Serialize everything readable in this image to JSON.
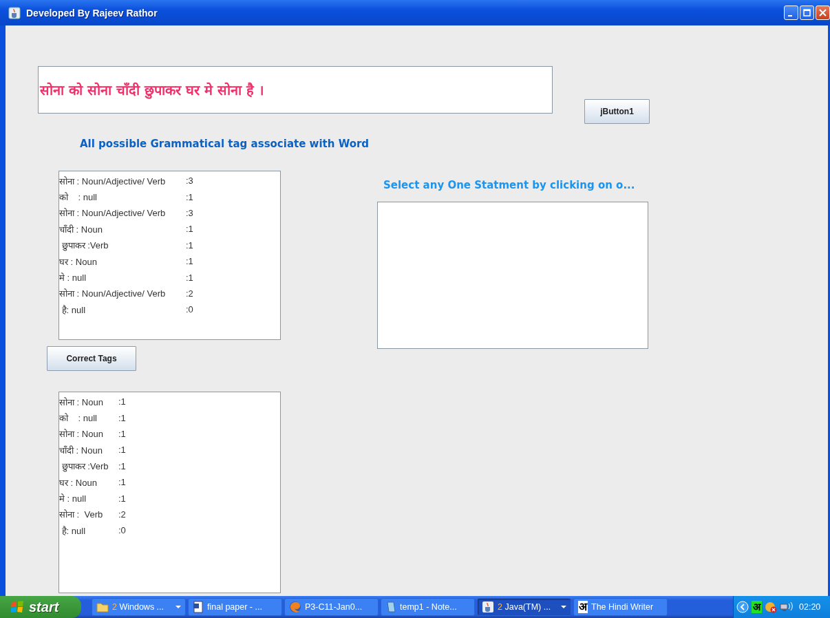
{
  "window": {
    "title": "Developed By Rajeev Rathor"
  },
  "sentence_field": {
    "value": "सोना को सोना चाँदी छुपाकर घर मे सोना है ।"
  },
  "top_button": {
    "label": "jButton1"
  },
  "possible_tags": {
    "label": "All possible Grammatical tag associate with Word",
    "rows": [
      {
        "text": "सोना : Noun/Adjective/ Verb",
        "count": ":3"
      },
      {
        "text": "को    : null",
        "count": ":1"
      },
      {
        "text": "सोना : Noun/Adjective/ Verb",
        "count": ":3"
      },
      {
        "text": "चाँदी : Noun",
        "count": ":1"
      },
      {
        "text": " छुपाकर :Verb",
        "count": ":1"
      },
      {
        "text": "घर : Noun",
        "count": ":1"
      },
      {
        "text": "मे : null",
        "count": ":1"
      },
      {
        "text": "सोना : Noun/Adjective/ Verb",
        "count": ":2"
      },
      {
        "text": " है: null",
        "count": ":0"
      }
    ]
  },
  "correct_tags_button": {
    "label": "Correct Tags"
  },
  "correct_tags": {
    "rows": [
      {
        "text": "सोना : Noun",
        "count": ":1"
      },
      {
        "text": "को    : null",
        "count": ":1"
      },
      {
        "text": "सोना : Noun",
        "count": ":1"
      },
      {
        "text": "चाँदी : Noun",
        "count": ":1"
      },
      {
        "text": " छुपाकर :Verb",
        "count": ":1"
      },
      {
        "text": "घर : Noun",
        "count": ":1"
      },
      {
        "text": "मे : null",
        "count": ":1"
      },
      {
        "text": "सोना :  Verb",
        "count": ":2"
      },
      {
        "text": " है: null",
        "count": ":0"
      }
    ]
  },
  "statement": {
    "label": "Select any One Statment by clicking on o..."
  },
  "taskbar": {
    "start": "start",
    "tasks": [
      {
        "kind": "folder",
        "count": "2",
        "label": "Windows ...",
        "grouped": true,
        "selected": false
      },
      {
        "kind": "document",
        "label": "final paper - ...",
        "grouped": false,
        "selected": false
      },
      {
        "kind": "browser",
        "label": "P3-C11-Jan0...",
        "grouped": false,
        "selected": false
      },
      {
        "kind": "notepad",
        "label": "temp1 - Note...",
        "grouped": false,
        "selected": false
      },
      {
        "kind": "java",
        "count": "2",
        "label": "Java(TM) ...",
        "grouped": true,
        "selected": true
      },
      {
        "kind": "letter",
        "icon_text": "अ",
        "label": "The Hindi Writer",
        "grouped": false,
        "selected": false
      }
    ],
    "tray": {
      "language": "अ",
      "clock": "02:20"
    }
  }
}
